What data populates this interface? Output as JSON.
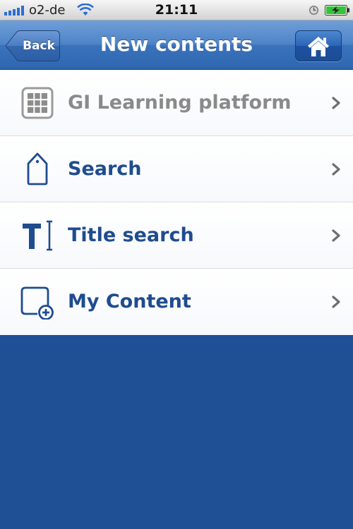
{
  "status_bar": {
    "carrier": "o2-de",
    "time": "21:11"
  },
  "nav": {
    "back_label": "Back",
    "title": "New contents",
    "home_icon": "home-icon"
  },
  "list": {
    "items": [
      {
        "label": "GI Learning platform",
        "icon": "grid-icon",
        "state": "disabled"
      },
      {
        "label": "Search",
        "icon": "tag-icon",
        "state": "enabled"
      },
      {
        "label": "Title search",
        "icon": "text-cursor-icon",
        "state": "enabled"
      },
      {
        "label": "My Content",
        "icon": "add-content-icon",
        "state": "enabled"
      }
    ]
  },
  "colors": {
    "accent": "#1f4c8f",
    "disabled_text": "#8a8a8a",
    "background": "#1f4f95",
    "nav_bar": "#3a72bb"
  }
}
